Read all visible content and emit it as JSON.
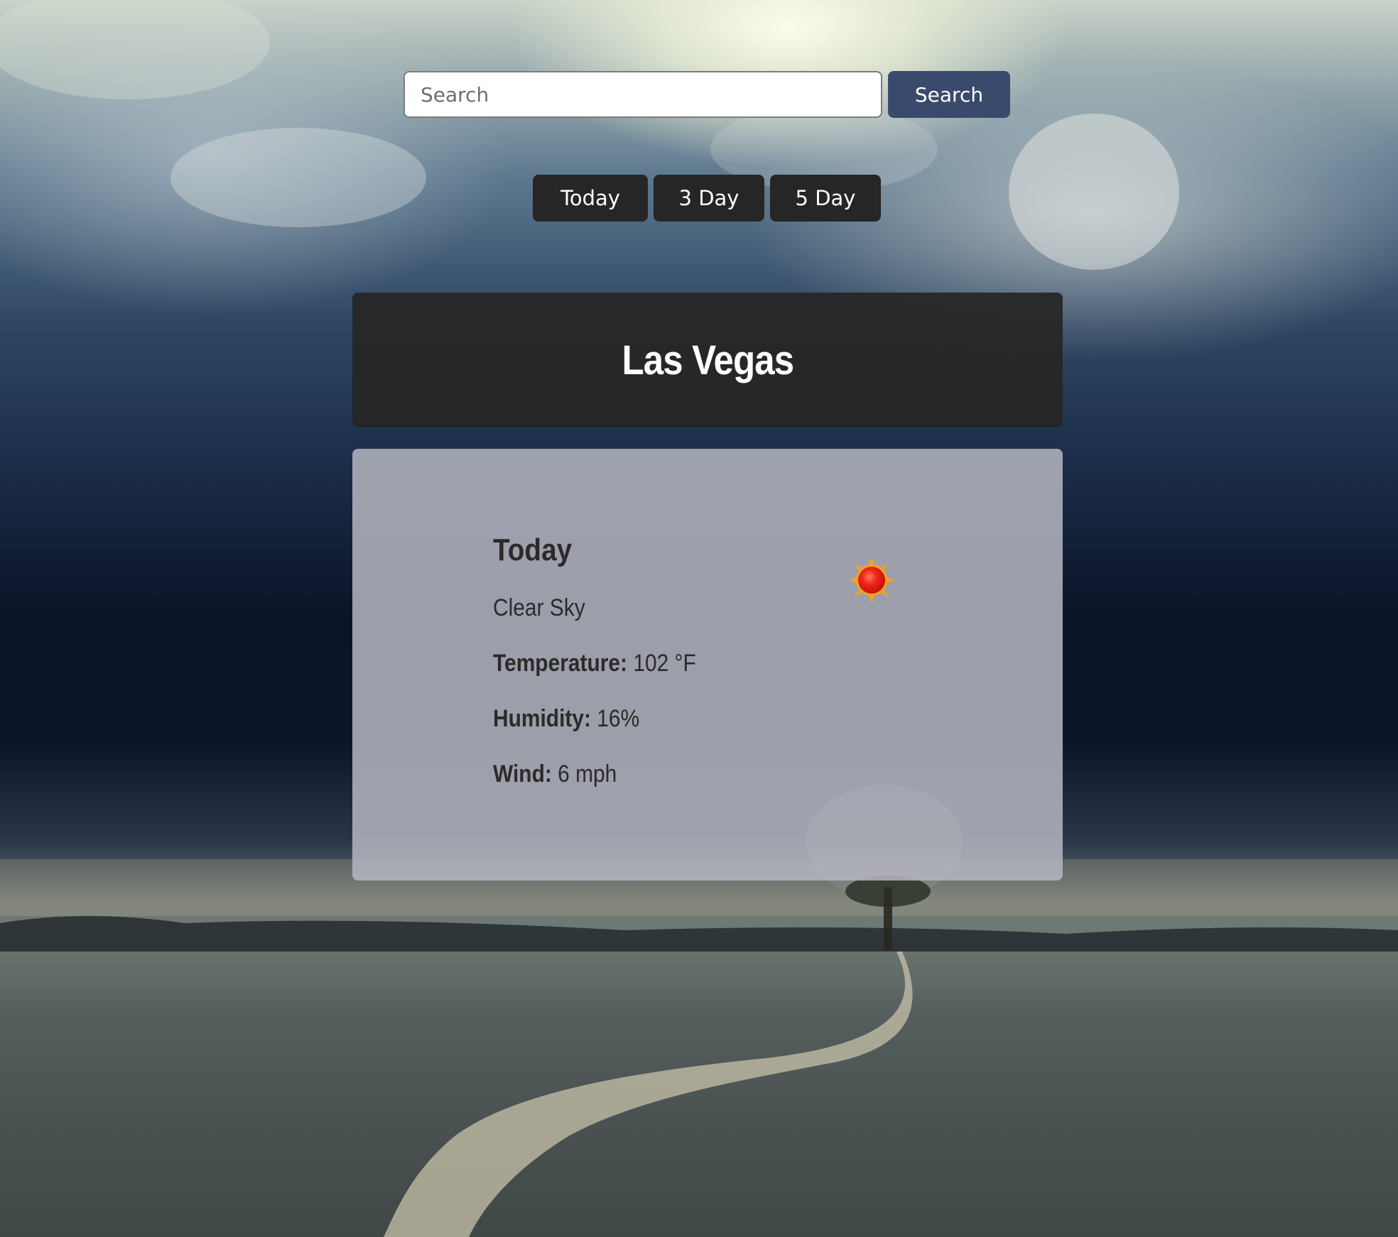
{
  "search": {
    "placeholder": "Search",
    "value": "",
    "button_label": "Search"
  },
  "tabs": [
    {
      "label": "Today"
    },
    {
      "label": "3 Day"
    },
    {
      "label": "5 Day"
    }
  ],
  "city": {
    "name": "Las Vegas"
  },
  "forecast": {
    "day_label": "Today",
    "condition": "Clear Sky",
    "temperature_label": "Temperature:",
    "temperature_value": "102 °F",
    "humidity_label": "Humidity:",
    "humidity_value": "16%",
    "wind_label": "Wind:",
    "wind_value": "6 mph",
    "icon": "sun-icon"
  },
  "colors": {
    "search_button": "#3a4a6d",
    "tab_button": "#262626",
    "header_bg": "#262626",
    "card_bg": "#b4b6c0",
    "sun_core": "#e81e10",
    "sun_rays": "#f7a21b"
  }
}
